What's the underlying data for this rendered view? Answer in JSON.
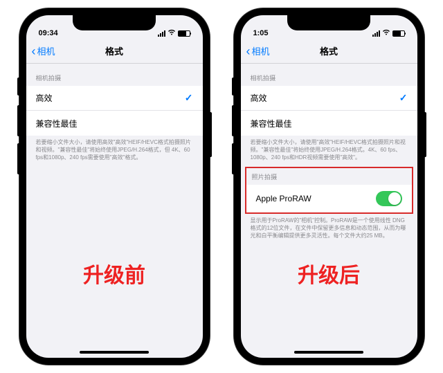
{
  "left": {
    "status_time": "09:34",
    "nav_back": "相机",
    "nav_title": "格式",
    "section1_header": "相机拍摄",
    "row_high_eff": "高效",
    "row_compat": "兼容性最佳",
    "section1_footer": "若要缩小文件大小，请使用高效\"高效\"HEIF/HEVC格式拍摄照片和视频。\"兼容性最佳\"将始终使用JPEG/H.264格式，但 4K、60 fps和1080p、240 fps需要使用\"高效\"格式。",
    "big_label": "升级前"
  },
  "right": {
    "status_time": "1:05",
    "nav_back": "相机",
    "nav_title": "格式",
    "section1_header": "相机拍摄",
    "row_high_eff": "高效",
    "row_compat": "兼容性最佳",
    "section1_footer": "若要缩小文件大小，请使用\"高效\"HEIF/HEVC格式拍摄照片和视频。\"兼容性最佳\"将始终使用JPEG/H.264格式。4K、60 fps、1080p、240 fps和HDR视频需要使用\"高效\"。",
    "section2_header": "照片拍摄",
    "row_proraw": "Apple ProRAW",
    "section2_footer": "显示用于ProRAW的\"相机\"控制。ProRAW是一个使用线性 DNG 格式的12位文件，在文件中保留更多信息和动态范围，从而为曝光和白平衡编辑提供更多灵活性。每个文件大约25 MB。",
    "big_label": "升级后"
  }
}
